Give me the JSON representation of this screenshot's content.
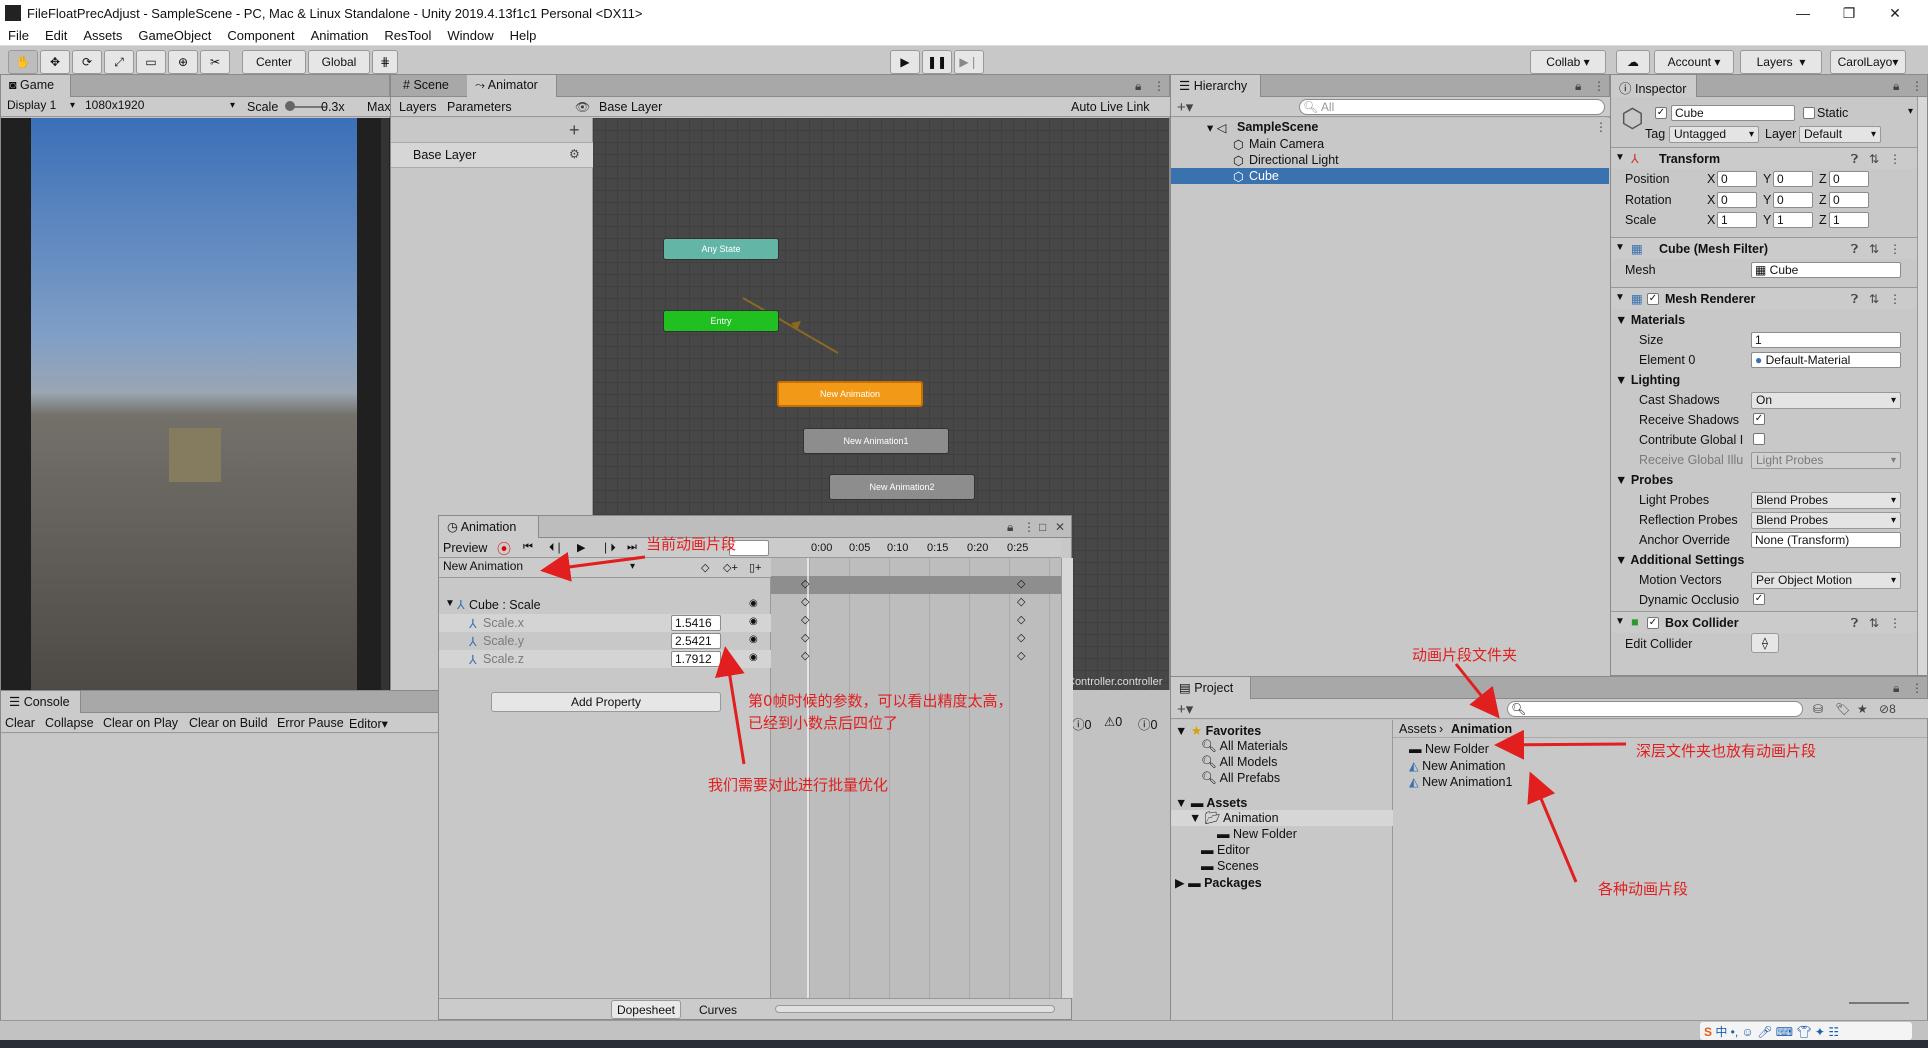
{
  "window": {
    "title": "FileFloatPrecAdjust - SampleScene - PC, Mac & Linux Standalone - Unity 2019.4.13f1c1 Personal <DX11>"
  },
  "menu": [
    "File",
    "Edit",
    "Assets",
    "GameObject",
    "Component",
    "Animation",
    "ResTool",
    "Window",
    "Help"
  ],
  "toolbar": {
    "center": "Center",
    "global": "Global",
    "collab": "Collab ▾",
    "account": "Account",
    "layers": "Layers",
    "user": "CarolLayo"
  },
  "game": {
    "tab": "Game",
    "display": "Display 1",
    "resolution": "1080x1920",
    "scale_label": "Scale",
    "scale_value": "0.3x",
    "max": "Max"
  },
  "animator": {
    "tab_scene": "Scene",
    "tab_animator": "Animator",
    "layers": "Layers",
    "parameters": "Parameters",
    "breadcrumb": "Base Layer",
    "auto_live": "Auto Live Link",
    "base_layer": "Base Layer",
    "nodes": {
      "any": "Any State",
      "entry": "Entry",
      "anim": "New Animation",
      "anim1": "New Animation1",
      "anim2": "New Animation2"
    },
    "controller": "Controller.controller"
  },
  "animation": {
    "tab": "Animation",
    "preview": "Preview",
    "clip": "New Animation",
    "object": "Cube : Scale",
    "props": [
      {
        "name": "Scale.x",
        "value": "1.5416"
      },
      {
        "name": "Scale.y",
        "value": "2.5421"
      },
      {
        "name": "Scale.z",
        "value": "1.7912"
      }
    ],
    "add_property": "Add Property",
    "dopesheet": "Dopesheet",
    "curves": "Curves",
    "ticks": [
      "0:00",
      "0:05",
      "0:10",
      "0:15",
      "0:20",
      "0:25"
    ]
  },
  "hierarchy": {
    "tab": "Hierarchy",
    "search": "All",
    "scene": "SampleScene",
    "items": [
      "Main Camera",
      "Directional Light",
      "Cube"
    ]
  },
  "inspector": {
    "tab": "Inspector",
    "object": "Cube",
    "static": "Static",
    "tag_label": "Tag",
    "tag": "Untagged",
    "layer_label": "Layer",
    "layer": "Default",
    "transform": "Transform",
    "position": "Position",
    "rotation": "Rotation",
    "scale": "Scale",
    "pos": [
      "0",
      "0",
      "0"
    ],
    "rot": [
      "0",
      "0",
      "0"
    ],
    "scl": [
      "1",
      "1",
      "1"
    ],
    "meshfilter": "Cube (Mesh Filter)",
    "mesh_label": "Mesh",
    "mesh": "Cube",
    "meshrenderer": "Mesh Renderer",
    "materials": "Materials",
    "size_label": "Size",
    "size": "1",
    "element0_label": "Element 0",
    "element0": "Default-Material",
    "lighting": "Lighting",
    "cast_shadows_label": "Cast Shadows",
    "cast_shadows": "On",
    "receive_shadows": "Receive Shadows",
    "contribute_gi": "Contribute Global I",
    "receive_gi_label": "Receive Global Illu",
    "receive_gi": "Light Probes",
    "probes": "Probes",
    "light_probes_label": "Light Probes",
    "light_probes": "Blend Probes",
    "refl_probes_label": "Reflection Probes",
    "refl_probes": "Blend Probes",
    "anchor_label": "Anchor Override",
    "anchor": "None (Transform)",
    "additional": "Additional Settings",
    "motion_label": "Motion Vectors",
    "motion": "Per Object Motion",
    "dynamic_occ": "Dynamic Occlusio",
    "boxcollider": "Box Collider",
    "edit_collider": "Edit Collider"
  },
  "console": {
    "tab": "Console",
    "buttons": [
      "Clear",
      "Collapse",
      "Clear on Play",
      "Clear on Build",
      "Error Pause",
      "Editor"
    ],
    "counts": [
      "0",
      "0",
      "0"
    ]
  },
  "project": {
    "tab": "Project",
    "favorites": "Favorites",
    "fav_items": [
      "All Materials",
      "All Models",
      "All Prefabs"
    ],
    "assets": "Assets",
    "tree": [
      "Animation",
      "New Folder",
      "Editor",
      "Scenes"
    ],
    "packages": "Packages",
    "crumb_root": "Assets",
    "crumb_current": "Animation",
    "files": [
      "New Folder",
      "New Animation",
      "New Animation1"
    ],
    "icon_count": "8"
  },
  "annotations": {
    "a1": "当前动画片段",
    "a2": "第0帧时候的参数，可以看出精度太高，",
    "a3": "已经到小数点后四位了",
    "a4": "我们需要对此进行批量优化",
    "a5": "动画片段文件夹",
    "a6": "深层文件夹也放有动画片段",
    "a7": "各种动画片段"
  },
  "colors": {
    "accent": "#3a72b0",
    "orange": "#f09a1c",
    "entry": "#1fbf1f",
    "anystate": "#5bb8a8",
    "annot": "#e11f1f"
  }
}
